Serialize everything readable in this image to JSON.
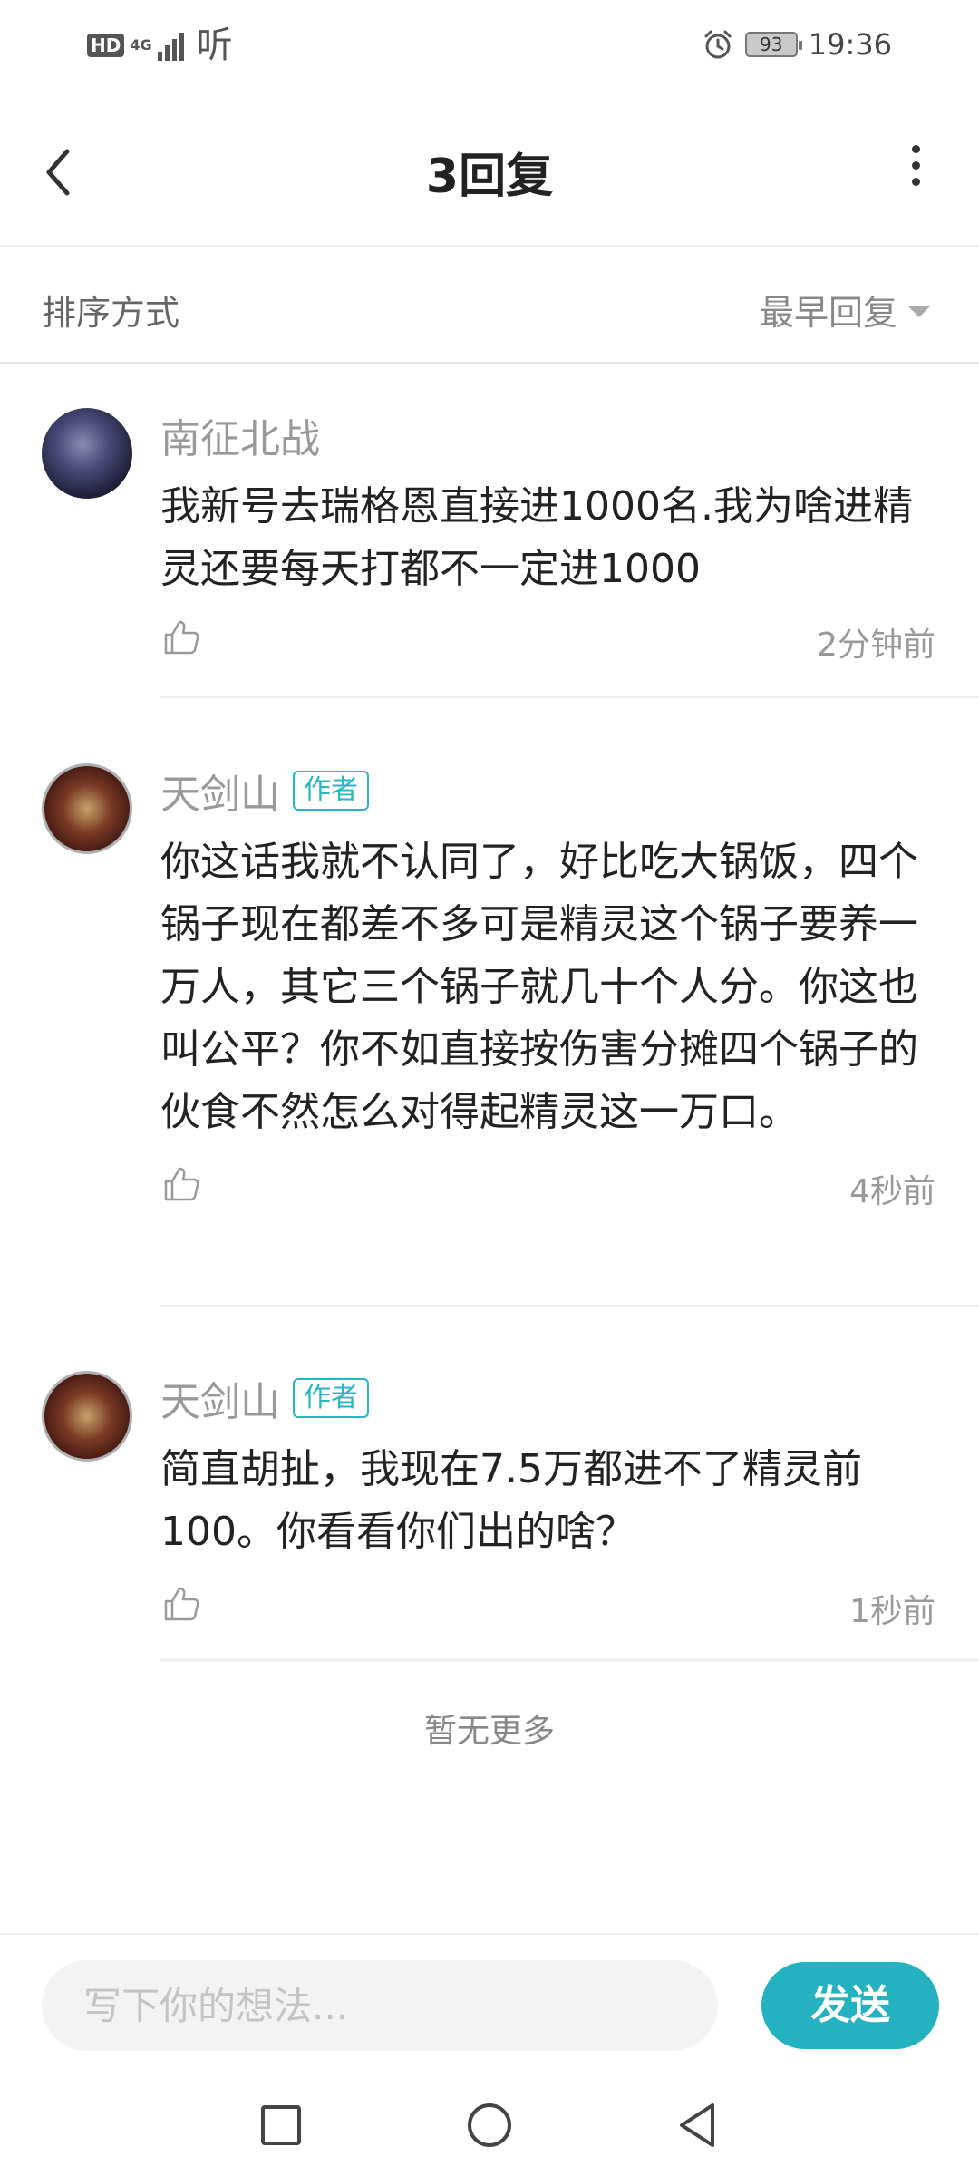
{
  "status_bar": {
    "hd": "HD",
    "network": "4G",
    "app_indicator": "听",
    "battery": "93",
    "time": "19:36",
    "icons": [
      "alarm-icon",
      "signal-icon",
      "battery-icon"
    ]
  },
  "header": {
    "title": "3回复",
    "back_icon": "chevron-left-icon",
    "more_icon": "more-vertical-icon"
  },
  "sort": {
    "label": "排序方式",
    "selected": "最早回复"
  },
  "comments": [
    {
      "username": "南征北战",
      "is_author": false,
      "text": "我新号去瑞格恩直接进1000名.我为啥进精灵还要每天打都不一定进1000",
      "time": "2分钟前"
    },
    {
      "username": "天剑山",
      "is_author": true,
      "badge": "作者",
      "text": "你这话我就不认同了，好比吃大锅饭，四个锅子现在都差不多可是精灵这个锅子要养一万人，其它三个锅子就几十个人分。你这也叫公平？你不如直接按伤害分摊四个锅子的伙食不然怎么对得起精灵这一万口。",
      "time": "4秒前"
    },
    {
      "username": "天剑山",
      "is_author": true,
      "badge": "作者",
      "text": "简直胡扯，我现在7.5万都进不了精灵前100。你看看你们出的啥？",
      "time": "1秒前"
    }
  ],
  "footer_note": "暂无更多",
  "input": {
    "placeholder": "写下你的想法...",
    "value": "",
    "send_label": "发送"
  },
  "colors": {
    "accent": "#25b2c0",
    "text_primary": "#222222",
    "text_secondary": "#999999"
  }
}
